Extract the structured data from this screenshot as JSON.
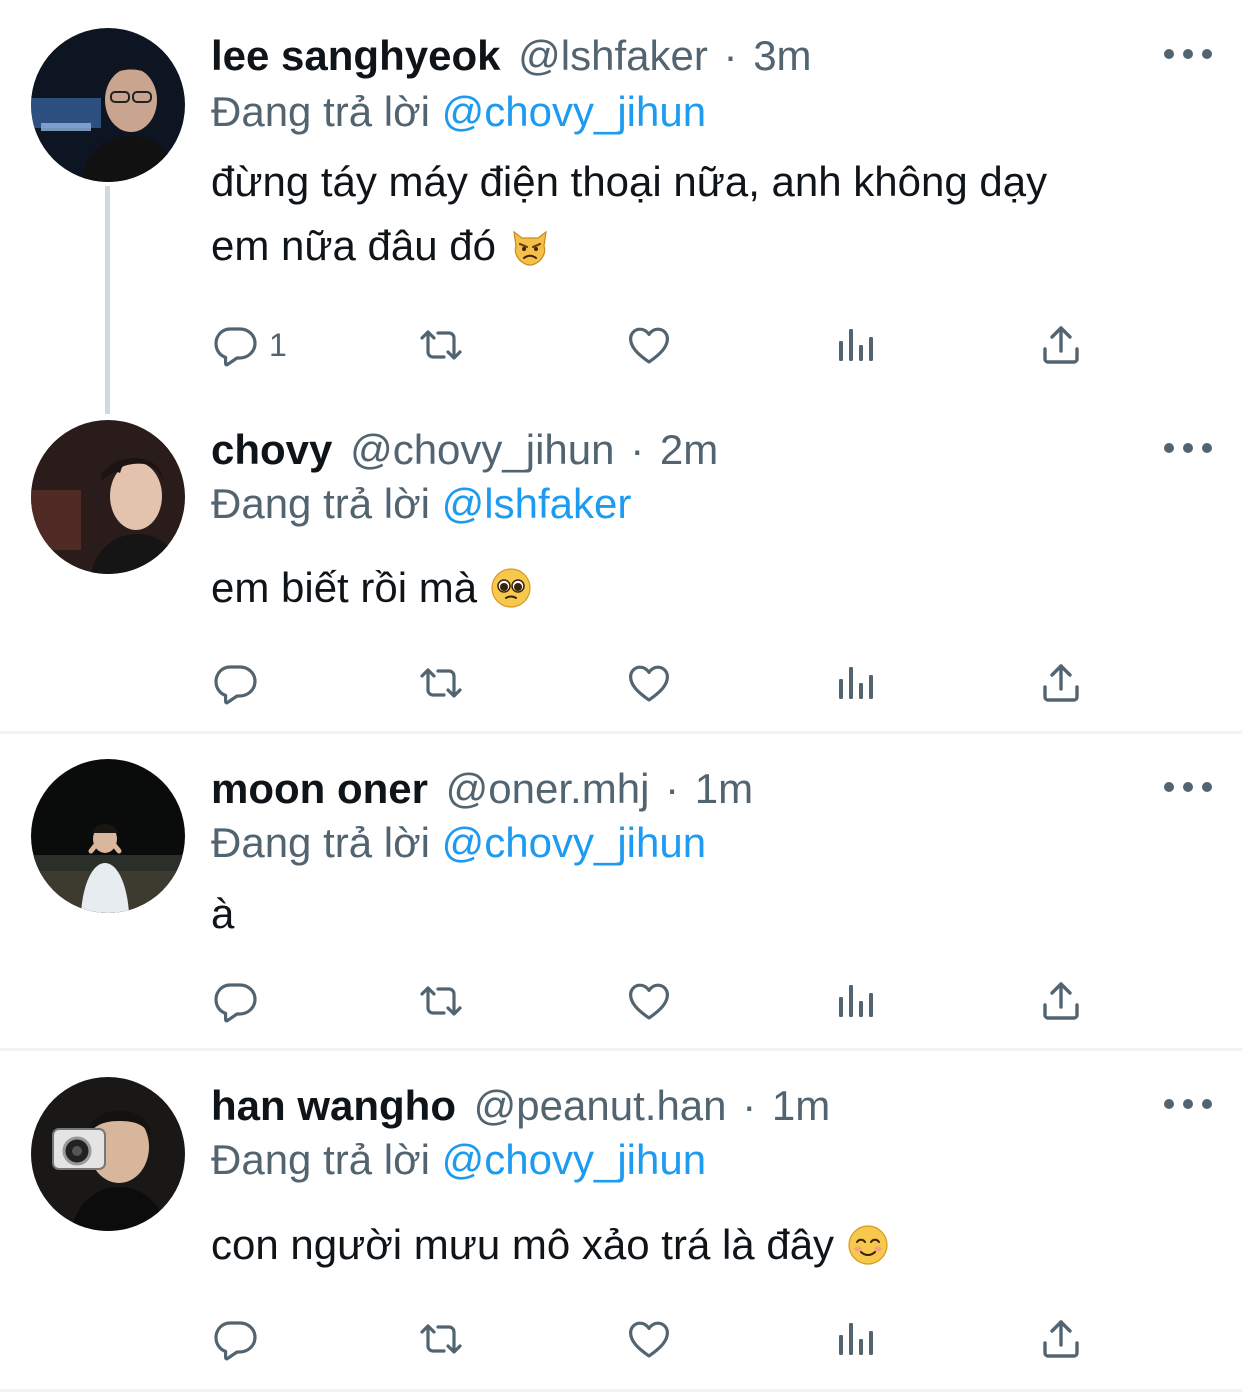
{
  "tweets": [
    {
      "name": "lee sanghyeok",
      "handle": "@lshfaker",
      "separator": "·",
      "time": "3m",
      "reply_prefix": "Đang trả lời",
      "reply_to": "@chovy_jihun",
      "text_line1": "đừng táy máy điện thoại nữa, anh không dạy",
      "text_line2": "em nữa đâu đó",
      "emoji": "angry-cat-emoji",
      "reply_count": "1"
    },
    {
      "name": "chovy",
      "handle": "@chovy_jihun",
      "separator": "·",
      "time": "2m",
      "reply_prefix": "Đang trả lời",
      "reply_to": "@lshfaker",
      "text_line1": "em biết rồi mà",
      "emoji": "pleading-face-emoji",
      "reply_count": ""
    },
    {
      "name": "moon oner",
      "handle": "@oner.mhj",
      "separator": "·",
      "time": "1m",
      "reply_prefix": "Đang trả lời",
      "reply_to": "@chovy_jihun",
      "text_line1": "à",
      "reply_count": ""
    },
    {
      "name": "han wangho",
      "handle": "@peanut.han",
      "separator": "·",
      "time": "1m",
      "reply_prefix": "Đang trả lời",
      "reply_to": "@chovy_jihun",
      "text_line1": "con người mưu mô xảo trá là đây",
      "emoji": "smiling-face-emoji",
      "reply_count": ""
    }
  ],
  "colors": {
    "text": "#0f1419",
    "secondary": "#536471",
    "link": "#1d9bf0",
    "divider": "#eff3f4",
    "thread_line": "#cfd9de"
  },
  "icons": [
    "reply-icon",
    "retweet-icon",
    "like-icon",
    "analytics-icon",
    "share-icon",
    "more-icon"
  ]
}
